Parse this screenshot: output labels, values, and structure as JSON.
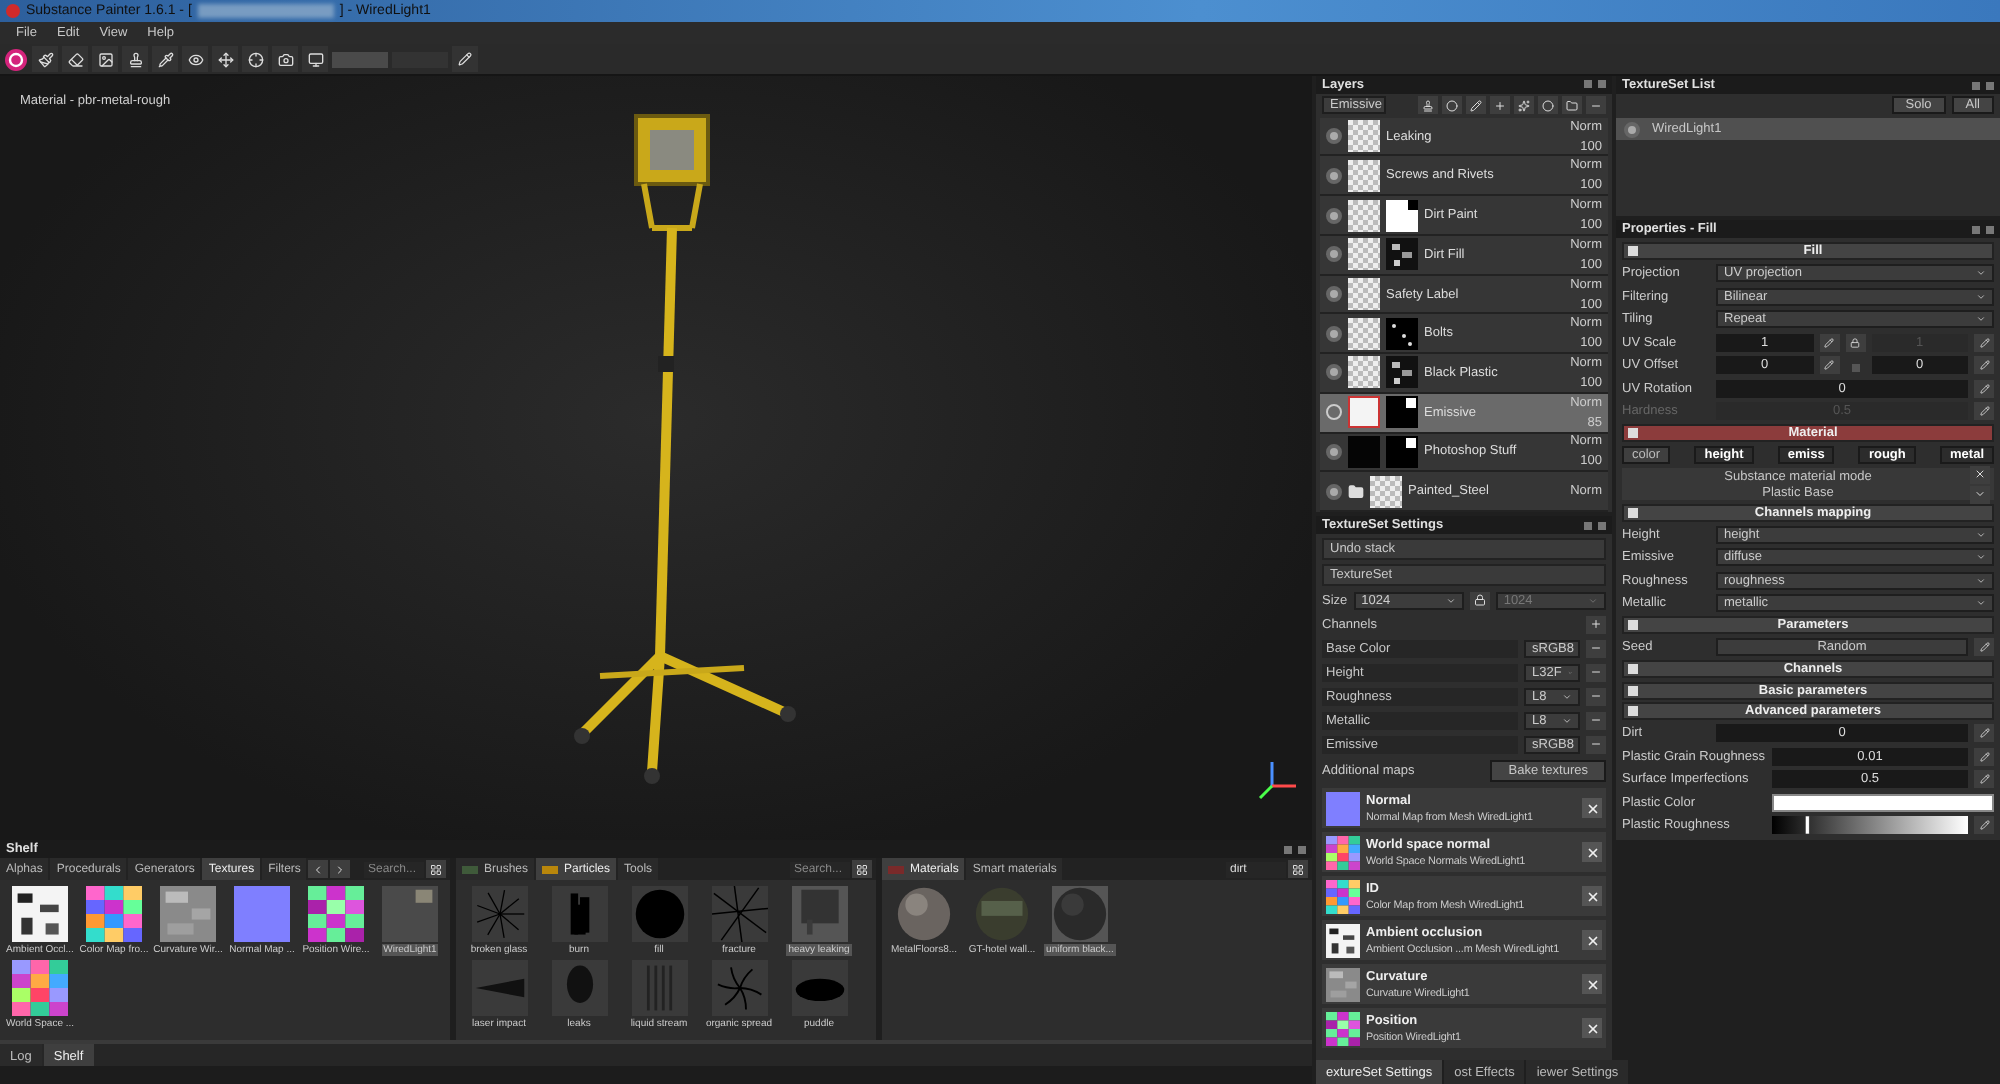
{
  "window": {
    "title": "Substance Painter 1.6.1 - [",
    "title_end": "] - WiredLight1"
  },
  "menu": [
    "File",
    "Edit",
    "View",
    "Help"
  ],
  "viewport": {
    "label": "Material - pbr-metal-rough"
  },
  "layers": {
    "title": "Layers",
    "channel": "Emissive",
    "items": [
      {
        "name": "Leaking",
        "blend": "Norm",
        "opacity": "100",
        "visible": true,
        "selected": false,
        "kind": "layer",
        "thumbnail": {
          "kind": "checker"
        }
      },
      {
        "name": "Screws and Rivets",
        "blend": "Norm",
        "opacity": "100",
        "visible": true,
        "selected": false,
        "kind": "layer",
        "thumbnail": {
          "kind": "checker"
        }
      },
      {
        "name": "Dirt Paint",
        "blend": "Norm",
        "opacity": "100",
        "visible": true,
        "selected": false,
        "kind": "layer",
        "thumbnail": {
          "kind": "checker"
        },
        "mask": {
          "kind": "white"
        }
      },
      {
        "name": "Dirt Fill",
        "blend": "Norm",
        "opacity": "100",
        "visible": true,
        "selected": false,
        "kind": "layer",
        "thumbnail": {
          "kind": "checker"
        },
        "mask": {
          "kind": "noise"
        }
      },
      {
        "name": "Safety Label",
        "blend": "Norm",
        "opacity": "100",
        "visible": true,
        "selected": false,
        "kind": "layer",
        "thumbnail": {
          "kind": "checker"
        }
      },
      {
        "name": "Bolts",
        "blend": "Norm",
        "opacity": "100",
        "visible": true,
        "selected": false,
        "kind": "layer",
        "thumbnail": {
          "kind": "checker"
        },
        "mask": {
          "kind": "dots"
        }
      },
      {
        "name": "Black Plastic",
        "blend": "Norm",
        "opacity": "100",
        "visible": true,
        "selected": false,
        "kind": "layer",
        "thumbnail": {
          "kind": "checker"
        },
        "mask": {
          "kind": "noise"
        }
      },
      {
        "name": "Emissive",
        "blend": "Norm",
        "opacity": "85",
        "visible": false,
        "selected": true,
        "kind": "layer",
        "thumbnail": {
          "kind": "white"
        },
        "mask": {
          "kind": "black"
        }
      },
      {
        "name": "Photoshop Stuff",
        "blend": "Norm",
        "opacity": "100",
        "visible": true,
        "selected": false,
        "kind": "layer",
        "thumbnail": {
          "kind": "black"
        },
        "mask": {
          "kind": "black"
        }
      },
      {
        "name": "Painted_Steel",
        "blend": "Norm",
        "visible": true,
        "selected": false,
        "kind": "folder",
        "thumbnail": {
          "kind": "checker"
        }
      }
    ]
  },
  "texture_set_settings": {
    "title": "TextureSet Settings",
    "undo": "Undo stack",
    "texture_set": "TextureSet",
    "size_label": "Size",
    "size": "1024",
    "size_linked": "1024",
    "channels_label": "Channels",
    "channels": [
      {
        "name": "Base Color",
        "format": "sRGB8"
      },
      {
        "name": "Height",
        "format": "L32F"
      },
      {
        "name": "Roughness",
        "format": "L8"
      },
      {
        "name": "Metallic",
        "format": "L8"
      },
      {
        "name": "Emissive",
        "format": "sRGB8"
      }
    ],
    "additional_label": "Additional maps",
    "bake": "Bake textures",
    "maps": [
      {
        "title": "Normal",
        "subtitle": "Normal Map from Mesh WiredLight1",
        "thumbnail": {
          "kind": "normal"
        }
      },
      {
        "title": "World space normal",
        "subtitle": "World Space Normals WiredLight1",
        "thumbnail": {
          "kind": "wsn"
        }
      },
      {
        "title": "ID",
        "subtitle": "Color Map from Mesh WiredLight1",
        "thumbnail": {
          "kind": "idmap"
        }
      },
      {
        "title": "Ambient occlusion",
        "subtitle": "Ambient Occlusion ...m Mesh WiredLight1",
        "thumbnail": {
          "kind": "ao"
        }
      },
      {
        "title": "Curvature",
        "subtitle": "Curvature WiredLight1",
        "thumbnail": {
          "kind": "curvature"
        }
      },
      {
        "title": "Position",
        "subtitle": "Position WiredLight1",
        "thumbnail": {
          "kind": "position"
        }
      }
    ],
    "tabs": [
      {
        "label": "extureSet Settings",
        "selected": true
      },
      {
        "label": "ost Effects",
        "selected": false
      },
      {
        "label": "iewer Settings",
        "selected": false
      }
    ]
  },
  "texture_set_list": {
    "title": "TextureSet List",
    "buttons": [
      "Solo",
      "All"
    ],
    "items": [
      {
        "name": "WiredLight1",
        "selected": true
      }
    ]
  },
  "properties": {
    "title": "Properties - Fill",
    "rows": [
      {
        "kind": "header",
        "label": "Fill",
        "accent": false
      },
      {
        "kind": "select",
        "label": "Projection",
        "value": "UV projection"
      },
      {
        "kind": "select",
        "label": "Filtering",
        "value": "Bilinear"
      },
      {
        "kind": "select",
        "label": "Tiling",
        "value": "Repeat"
      },
      {
        "kind": "pair",
        "label": "UV Scale",
        "values": [
          {
            "text": "1",
            "disabled": false
          },
          {
            "text": "1",
            "disabled": true
          }
        ],
        "locked": true
      },
      {
        "kind": "pair",
        "label": "UV Offset",
        "values": [
          {
            "text": "0",
            "disabled": false
          },
          {
            "text": "0",
            "disabled": false
          }
        ],
        "locked": false
      },
      {
        "kind": "number",
        "label": "UV Rotation",
        "value": "0",
        "disabled": false
      },
      {
        "kind": "number",
        "label": "Hardness",
        "value": "0.5",
        "disabled": true
      },
      {
        "kind": "header",
        "label": "Material",
        "accent": true
      },
      {
        "kind": "channels",
        "items": [
          {
            "label": "color",
            "on": false
          },
          {
            "label": "height",
            "on": true
          },
          {
            "label": "emiss",
            "on": true
          },
          {
            "label": "rough",
            "on": true
          },
          {
            "label": "metal",
            "on": true
          }
        ]
      },
      {
        "kind": "mode",
        "label": "Substance material mode",
        "value": "Plastic Base"
      },
      {
        "kind": "header",
        "label": "Channels mapping",
        "accent": false
      },
      {
        "kind": "select",
        "label": "Height",
        "value": "height"
      },
      {
        "kind": "select",
        "label": "Emissive",
        "value": "diffuse"
      },
      {
        "kind": "select",
        "label": "Roughness",
        "value": "roughness"
      },
      {
        "kind": "select",
        "label": "Metallic",
        "value": "metallic"
      },
      {
        "kind": "header",
        "label": "Parameters",
        "accent": false
      },
      {
        "kind": "button",
        "label": "Seed",
        "value": "Random"
      },
      {
        "kind": "header",
        "label": "Channels",
        "accent": false
      },
      {
        "kind": "header",
        "label": "Basic parameters",
        "accent": false
      },
      {
        "kind": "header",
        "label": "Advanced parameters",
        "accent": false
      },
      {
        "kind": "number",
        "label": "Dirt",
        "value": "0",
        "disabled": false
      },
      {
        "kind": "number",
        "label": "Plastic Grain Roughness",
        "value": "0.01",
        "disabled": false
      },
      {
        "kind": "number",
        "label": "Surface Imperfections",
        "value": "0.5",
        "disabled": false
      },
      {
        "kind": "color",
        "label": "Plastic Color",
        "color": "#ffffff"
      },
      {
        "kind": "gradient",
        "label": "Plastic Roughness",
        "level": 0.18
      }
    ]
  },
  "shelf": {
    "title": "Shelf",
    "panels": [
      {
        "tabs": [
          {
            "label": "Alphas",
            "selected": false
          },
          {
            "label": "Procedurals",
            "selected": false
          },
          {
            "label": "Generators",
            "selected": false
          },
          {
            "label": "Textures",
            "selected": true
          },
          {
            "label": "Filters",
            "selected": false
          }
        ],
        "search": {
          "placeholder": "Search..."
        },
        "items": [
          {
            "label": "Ambient Occl...",
            "thumbnail": {
              "kind": "ao"
            },
            "selected": false
          },
          {
            "label": "Color Map fro...",
            "thumbnail": {
              "kind": "idmap"
            },
            "selected": false
          },
          {
            "label": "Curvature Wir...",
            "thumbnail": {
              "kind": "curvature"
            },
            "selected": false
          },
          {
            "label": "Normal Map ...",
            "thumbnail": {
              "kind": "normal"
            },
            "selected": false
          },
          {
            "label": "Position Wire...",
            "thumbnail": {
              "kind": "position"
            },
            "selected": false
          },
          {
            "label": "WiredLight1",
            "thumbnail": {
              "kind": "blank"
            },
            "selected": true
          },
          {
            "label": "World Space ...",
            "thumbnail": {
              "kind": "wsn"
            },
            "selected": false
          }
        ]
      },
      {
        "tabs": [
          {
            "label": "Brushes",
            "selected": false,
            "color": "#3f5a3a"
          },
          {
            "label": "Particles",
            "selected": true,
            "color": "#b8860b"
          },
          {
            "label": "Tools",
            "selected": false
          }
        ],
        "search": {
          "placeholder": "Search..."
        },
        "items": [
          {
            "label": "broken glass",
            "thumbnail": {
              "kind": "burst"
            },
            "selected": false
          },
          {
            "label": "burn",
            "thumbnail": {
              "kind": "burn"
            },
            "selected": false
          },
          {
            "label": "fill",
            "thumbnail": {
              "kind": "disc"
            },
            "selected": false
          },
          {
            "label": "fracture",
            "thumbnail": {
              "kind": "cracks"
            },
            "selected": false
          },
          {
            "label": "heavy leaking",
            "thumbnail": {
              "kind": "drip"
            },
            "selected": true
          },
          {
            "label": "laser impact",
            "thumbnail": {
              "kind": "streak"
            },
            "selected": false
          },
          {
            "label": "leaks",
            "thumbnail": {
              "kind": "splat"
            },
            "selected": false
          },
          {
            "label": "liquid stream",
            "thumbnail": {
              "kind": "stream"
            },
            "selected": false
          },
          {
            "label": "organic spread",
            "thumbnail": {
              "kind": "spread"
            },
            "selected": false
          },
          {
            "label": "puddle",
            "thumbnail": {
              "kind": "puddle"
            },
            "selected": false
          }
        ]
      },
      {
        "tabs": [
          {
            "label": "Materials",
            "selected": true,
            "color": "#7a2a2a"
          },
          {
            "label": "Smart materials",
            "selected": false
          }
        ],
        "search": {
          "value": "dirt"
        },
        "items": [
          {
            "label": "MetalFloors8...",
            "thumbnail": {
              "kind": "metal-sphere"
            },
            "selected": false
          },
          {
            "label": "GT-hotel wall...",
            "thumbnail": {
              "kind": "wall-sphere"
            },
            "selected": false
          },
          {
            "label": "uniform black...",
            "thumbnail": {
              "kind": "dark-sphere"
            },
            "selected": true
          }
        ]
      }
    ]
  },
  "bottom_tabs": [
    {
      "label": "Log",
      "selected": false
    },
    {
      "label": "Shelf",
      "selected": true
    }
  ]
}
